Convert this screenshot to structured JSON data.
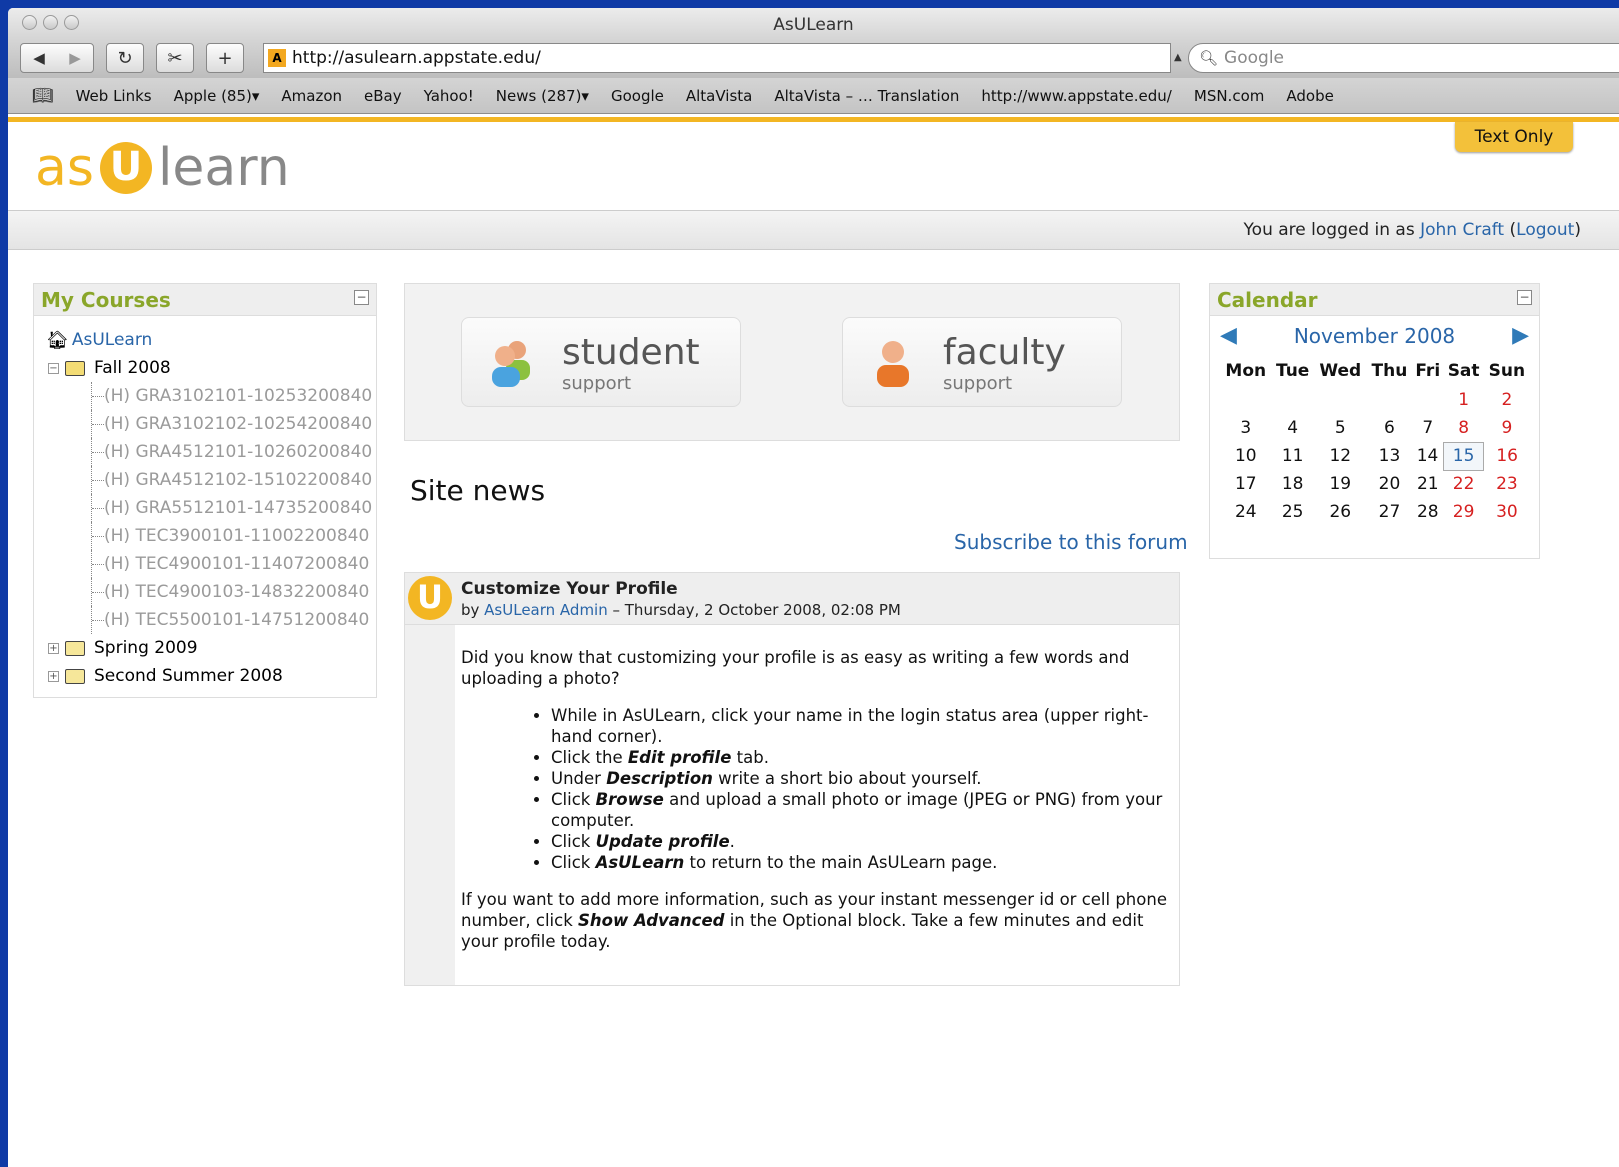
{
  "window": {
    "title": "AsULearn"
  },
  "toolbar": {
    "back_icon": "◀",
    "forward_icon": "▶",
    "reload_icon": "↻",
    "snap_icon": "✂",
    "add_icon": "+",
    "url": "http://asulearn.appstate.edu/",
    "search_placeholder": "Google"
  },
  "bookmarks": [
    "Web Links",
    "Apple (85)▾",
    "Amazon",
    "eBay",
    "Yahoo!",
    "News (287)▾",
    "Google",
    "AltaVista",
    "AltaVista – … Translation",
    "http://www.appstate.edu/",
    "MSN.com",
    "Adobe"
  ],
  "header": {
    "logo_as": "as",
    "logo_u": "U",
    "logo_learn": "learn",
    "text_only": "Text Only"
  },
  "login": {
    "prefix": "You are logged in as ",
    "user": "John Craft",
    "logout_open": " (",
    "logout": "Logout",
    "logout_close": ")"
  },
  "courses": {
    "title": "My Courses",
    "home": "AsULearn",
    "fall": "Fall 2008",
    "items": [
      "(H) GRA3102101-10253200840",
      "(H) GRA3102102-10254200840",
      "(H) GRA4512101-10260200840",
      "(H) GRA4512102-15102200840",
      "(H) GRA5512101-14735200840",
      "(H) TEC3900101-11002200840",
      "(H) TEC4900101-11407200840",
      "(H) TEC4900103-14832200840",
      "(H) TEC5500101-14751200840"
    ],
    "spring": "Spring 2009",
    "summer": "Second Summer 2008"
  },
  "support": {
    "student": "student",
    "faculty": "faculty",
    "sub": "support"
  },
  "news": {
    "title": "Site news",
    "subscribe": "Subscribe to this forum",
    "post_title": "Customize Your Profile",
    "by": "by ",
    "author": "AsULearn Admin",
    "date": " – Thursday, 2 October 2008, 02:08 PM",
    "intro": "Did you know that customizing your profile is as easy as writing a few words and uploading a photo?",
    "b1": "While in AsULearn, click your name in the login status area (upper right-hand corner).",
    "b2a": "Click the ",
    "b2b": "Edit profile",
    "b2c": " tab.",
    "b3a": "Under ",
    "b3b": "Description",
    "b3c": " write a short bio about yourself.",
    "b4a": "Click ",
    "b4b": "Browse",
    "b4c": " and upload a small photo or image (JPEG or PNG) from your computer.",
    "b5a": "Click ",
    "b5b": "Update profile",
    "b5c": ".",
    "b6a": "Click ",
    "b6b": "AsULearn",
    "b6c": " to return to the main AsULearn page.",
    "outro_a": "If you want to add more information, such as your instant messenger id or cell phone number, click ",
    "outro_b": "Show Advanced",
    "outro_c": " in the Optional block. Take a few minutes and edit your profile today."
  },
  "calendar": {
    "title": "Calendar",
    "month": "November 2008",
    "days": [
      "Mon",
      "Tue",
      "Wed",
      "Thu",
      "Fri",
      "Sat",
      "Sun"
    ],
    "weeks": [
      [
        "",
        "",
        "",
        "",
        "",
        "1",
        "2"
      ],
      [
        "3",
        "4",
        "5",
        "6",
        "7",
        "8",
        "9"
      ],
      [
        "10",
        "11",
        "12",
        "13",
        "14",
        "15",
        "16"
      ],
      [
        "17",
        "18",
        "19",
        "20",
        "21",
        "22",
        "23"
      ],
      [
        "24",
        "25",
        "26",
        "27",
        "28",
        "29",
        "30"
      ]
    ],
    "today": "15"
  },
  "colors": {
    "accent": "#f3b623",
    "link": "#2965a8",
    "heading_green": "#8aa62a",
    "weekend": "#d62020"
  }
}
